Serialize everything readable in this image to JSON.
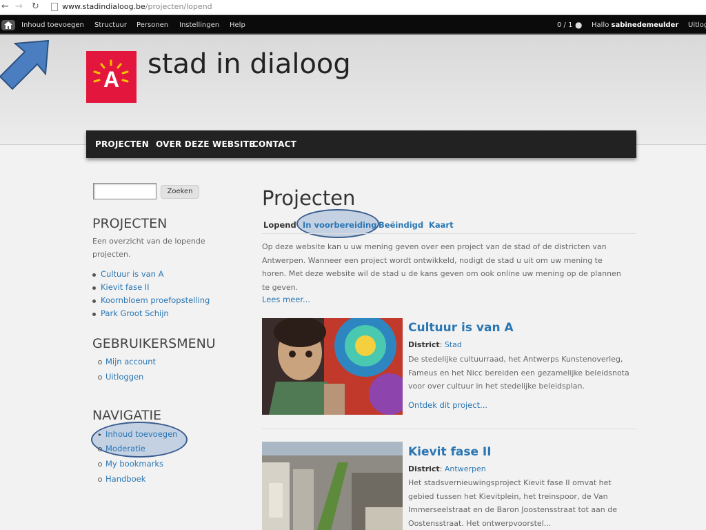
{
  "browser": {
    "url_host": "www.stadindialoog.be",
    "url_path": "/projecten/lopend"
  },
  "toolbar": {
    "items": [
      "Inhoud toevoegen",
      "Structuur",
      "Personen",
      "Instellingen",
      "Help"
    ],
    "counter": "0 / 1",
    "greeting": "Hallo",
    "username": "sabinedemeulder",
    "logout": "Uitlog"
  },
  "site": {
    "name": "stad in dialoog",
    "logo_letter": "A",
    "brand_color": "#e3173e"
  },
  "mainmenu": [
    "PROJECTEN",
    "OVER DEZE WEBSITE",
    "CONTACT"
  ],
  "search": {
    "button": "Zoeken",
    "value": ""
  },
  "sidebar": {
    "projecten": {
      "title": "PROJECTEN",
      "text_line1": "Een overzicht van de lopende",
      "text_line2": "projecten.",
      "links": [
        "Cultuur is van A",
        "Kievit fase II",
        "Koornbloem proefopstelling",
        "Park Groot Schijn"
      ]
    },
    "gebruikersmenu": {
      "title": "GEBRUIKERSMENU",
      "links": [
        "Mijn account",
        "Uitloggen"
      ]
    },
    "navigatie": {
      "title": "NAVIGATIE",
      "links": [
        "Inhoud toevoegen",
        "Moderatie",
        "My bookmarks",
        "Handboek"
      ]
    }
  },
  "content": {
    "title": "Projecten",
    "tabs": [
      "Lopend",
      "In voorbereiding",
      "Beëindigd",
      "Kaart"
    ],
    "intro_lines": [
      "Op deze website kan u uw mening geven over een project van de stad of de districten van",
      "Antwerpen. Wanneer een project wordt ontwikkeld, nodigt de stad u uit om uw mening te",
      "horen. Met deze website wil de stad u de kans geven om ook online uw mening op de plannen",
      "te geven."
    ],
    "read_more": "Lees meer...",
    "projects": [
      {
        "title": "Cultuur is van A",
        "district_label": "District",
        "district": "Stad",
        "desc_lines": [
          "De stedelijke cultuurraad, het Antwerps Kunstenoverleg,",
          "Fameus en het Nicc bereiden een gezamelijke beleidsnota",
          "voor over cultuur in het stedelijke beleidsplan."
        ],
        "more": "Ontdek dit project..."
      },
      {
        "title": "Kievit fase II",
        "district_label": "District",
        "district": "Antwerpen",
        "desc_lines": [
          "Het stadsvernieuwingsproject Kievit fase II omvat het",
          "gebied tussen het Kievitplein, het treinspoor, de Van",
          "Immerseelstraat en de Baron Joostensstraat tot aan de",
          "Oostensstraat. Het ontwerpvoorstel..."
        ],
        "more": ""
      }
    ]
  }
}
